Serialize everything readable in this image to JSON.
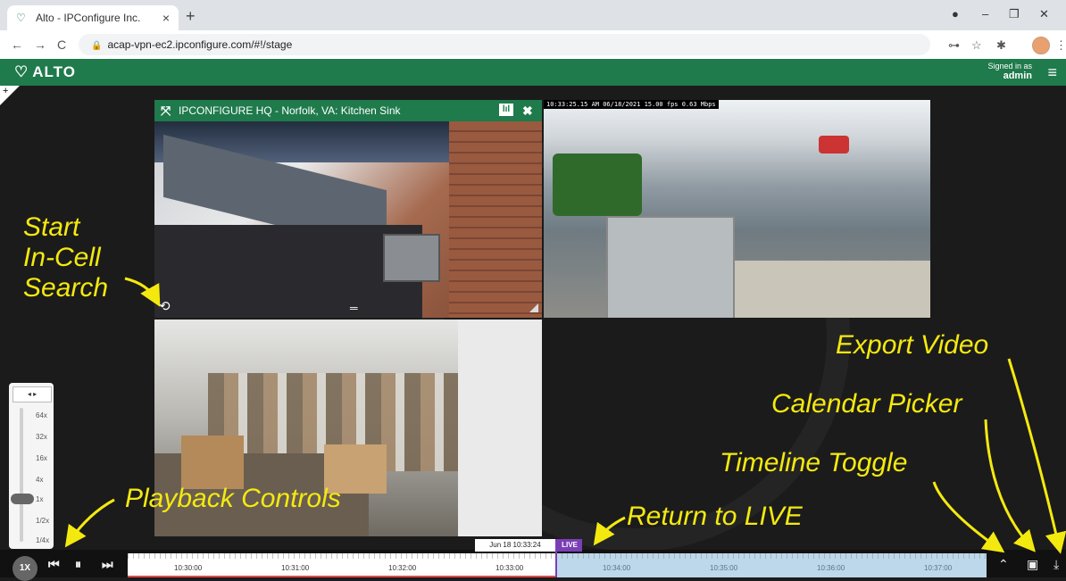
{
  "browser": {
    "tab_title": "Alto - IPConfigure Inc.",
    "tab_close": "×",
    "new_tab": "+",
    "url": "acap-vpn-ec2.ipconfigure.com/#!/stage",
    "back": "←",
    "forward": "→",
    "reload": "C",
    "lock": "🔒",
    "key": "⊶",
    "star": "☆",
    "ext": "✱",
    "menu": "⋮",
    "record": "●",
    "minimize": "–",
    "restore": "❐",
    "close": "✕"
  },
  "app": {
    "logo_text": "ALTO",
    "logo_mark": "♡",
    "signed_in_label": "Signed in as",
    "user": "admin",
    "menu_icon": "≡",
    "plus": "+"
  },
  "cells": [
    {
      "title": "IPCONFIGURE HQ - Norfolk, VA: Kitchen Sink",
      "expand_icon": "⤧",
      "stats_icon": "lıl",
      "close_icon": "✖",
      "search_icon": "⟲",
      "menu_icon": "═"
    },
    {
      "overlay": "10:33:25.15 AM 06/18/2021 15.00 fps  0.63 Mbps"
    },
    {}
  ],
  "speed": {
    "arrows": "◂ ▸",
    "labels": [
      "64x",
      "32x",
      "16x",
      "4x",
      "1x",
      "1/2x",
      "1/4x"
    ],
    "current": "1x"
  },
  "playback": {
    "rate": "1X",
    "prev": "⏮",
    "pause": "⏸",
    "next": "⏭"
  },
  "timeline": {
    "current_time": "Jun 18 10:33:24",
    "live_label": "LIVE",
    "ticks": [
      "10:30:00",
      "10:31:00",
      "10:32:00",
      "10:33:00",
      "10:34:00",
      "10:35:00",
      "10:36:00",
      "10:37:00"
    ],
    "toggle_icon": "⌃",
    "calendar_icon": "▣",
    "export_icon": "⤓"
  },
  "annotations": {
    "start_incell_1": "Start",
    "start_incell_2": "In-Cell",
    "start_incell_3": "Search",
    "playback": "Playback Controls",
    "return_live": "Return to LIVE",
    "export": "Export Video",
    "calendar": "Calendar Picker",
    "timeline_toggle": "Timeline Toggle"
  },
  "colors": {
    "accent_green": "#1f7a4c",
    "live_purple": "#7b3fb5",
    "annotation_yellow": "#f4e90f"
  }
}
